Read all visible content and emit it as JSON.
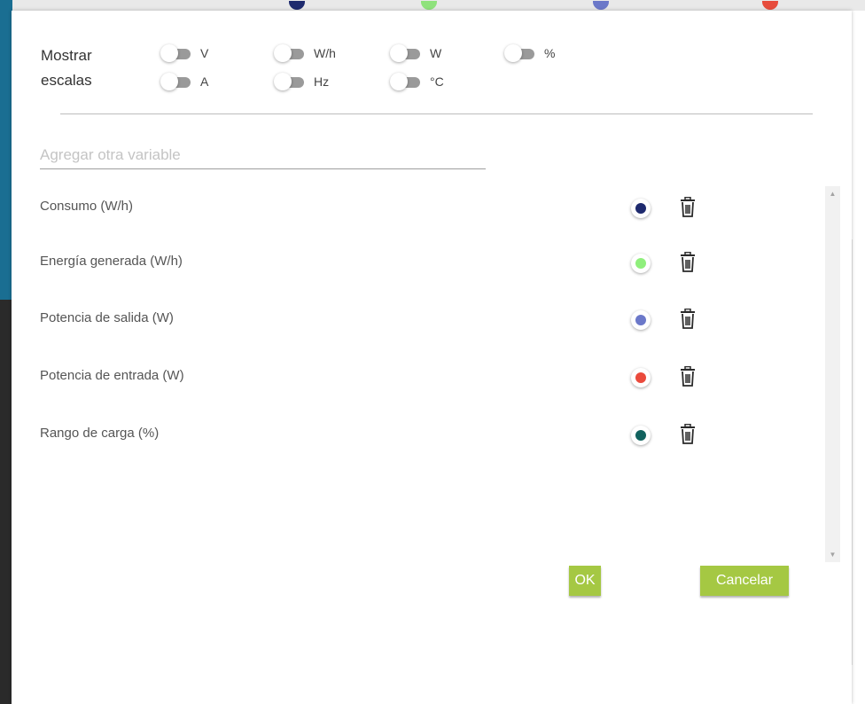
{
  "colors": {
    "accent_button": "#a5c843",
    "toggle_track": "#9a9a9a",
    "app_edge_blue": "#1a6e92"
  },
  "background_series_dots": [
    "#1e2a6e",
    "#8fe27c",
    "#6b78c9",
    "#e74c3c"
  ],
  "scales": {
    "label": "Mostrar escalas",
    "toggles": [
      {
        "label": "V",
        "on": false
      },
      {
        "label": "W/h",
        "on": false
      },
      {
        "label": "W",
        "on": false
      },
      {
        "label": "%",
        "on": false
      },
      {
        "label": "A",
        "on": false
      },
      {
        "label": "Hz",
        "on": false
      },
      {
        "label": "°C",
        "on": false
      }
    ]
  },
  "add_variable": {
    "placeholder": "Agregar otra variable",
    "value": ""
  },
  "variables": [
    {
      "label": "Consumo (W/h)",
      "color": "#1e2a6e",
      "delete_icon": "trash-icon"
    },
    {
      "label": "Energía generada (W/h)",
      "color": "#8fef7c",
      "delete_icon": "trash-icon"
    },
    {
      "label": "Potencia de salida (W)",
      "color": "#6b78c9",
      "delete_icon": "trash-icon"
    },
    {
      "label": "Potencia de entrada (W)",
      "color": "#ea4a3c",
      "delete_icon": "trash-icon"
    },
    {
      "label": "Rango de carga (%)",
      "color": "#11625e",
      "delete_icon": "trash-icon"
    }
  ],
  "buttons": {
    "ok": "OK",
    "cancel": "Cancelar"
  }
}
